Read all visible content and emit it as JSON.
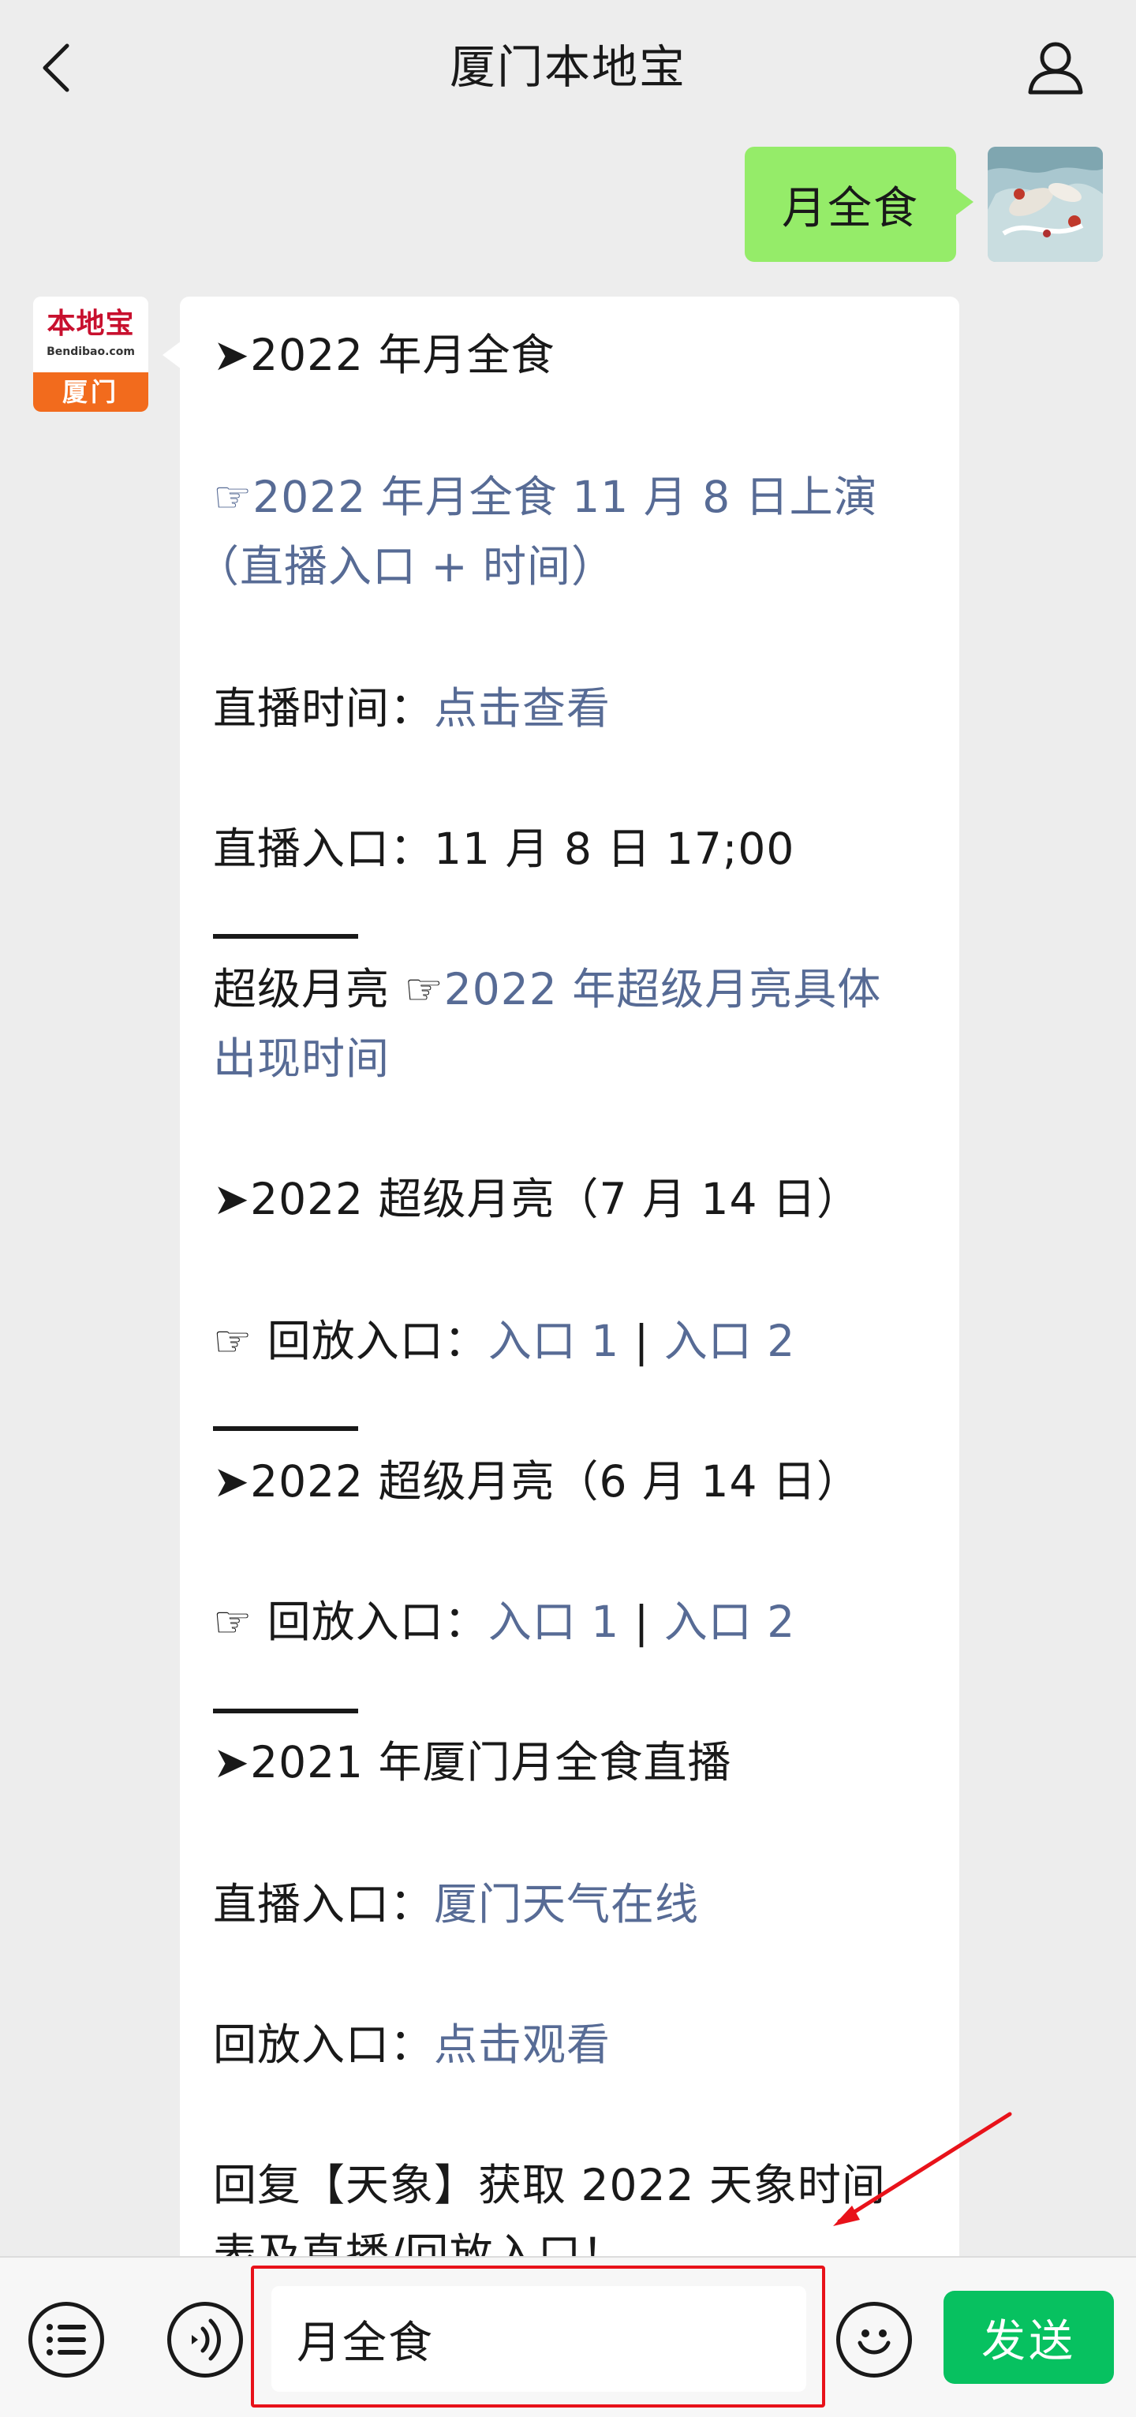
{
  "header": {
    "title": "厦门本地宝",
    "back_icon": "chevron-left-icon",
    "user_icon": "user-icon"
  },
  "sent_message": {
    "text": "月全食"
  },
  "bot_avatar": {
    "name": "本地宝",
    "url": "Bendibao.com",
    "city": "厦门"
  },
  "reply": {
    "lines": [
      {
        "type": "text",
        "parts": [
          {
            "t": "➤2022 年月全食"
          }
        ]
      },
      {
        "type": "text",
        "parts": [
          {
            "t": "☞2022 年月全食 11 月 8 日上演",
            "link": true
          }
        ]
      },
      {
        "type": "text",
        "parts": [
          {
            "t": "（直播入口 + 时间）",
            "link": true
          }
        ]
      },
      {
        "type": "text",
        "parts": [
          {
            "t": "直播时间："
          },
          {
            "t": "点击查看",
            "link": true
          }
        ]
      },
      {
        "type": "text",
        "parts": [
          {
            "t": "直播入口：11 月 8 日 17;00"
          }
        ]
      },
      {
        "type": "text",
        "parts": [
          {
            "t": "超级月亮 ☞"
          },
          {
            "t": "2022 年超级月亮具体",
            "link": true
          }
        ]
      },
      {
        "type": "text",
        "parts": [
          {
            "t": "出现时间",
            "link": true
          }
        ]
      },
      {
        "type": "text",
        "parts": [
          {
            "t": "➤2022 超级月亮（7 月 14 日）"
          }
        ]
      },
      {
        "type": "text",
        "parts": [
          {
            "t": "☞ 回放入口："
          },
          {
            "t": "入口 1",
            "link": true
          },
          {
            "t": " | "
          },
          {
            "t": "入口 2",
            "link": true
          }
        ]
      },
      {
        "type": "text",
        "parts": [
          {
            "t": "➤2022 超级月亮（6 月 14 日）"
          }
        ]
      },
      {
        "type": "text",
        "parts": [
          {
            "t": "☞ 回放入口："
          },
          {
            "t": "入口 1",
            "link": true
          },
          {
            "t": " | "
          },
          {
            "t": "入口 2",
            "link": true
          }
        ]
      },
      {
        "type": "text",
        "parts": [
          {
            "t": "➤2021 年厦门月全食直播"
          }
        ]
      },
      {
        "type": "text",
        "parts": [
          {
            "t": "直播入口："
          },
          {
            "t": "厦门天气在线",
            "link": true
          }
        ]
      },
      {
        "type": "text",
        "parts": [
          {
            "t": "回放入口："
          },
          {
            "t": "点击观看",
            "link": true
          }
        ]
      },
      {
        "type": "text",
        "parts": [
          {
            "t": "回复【天象】获取 2022 天象时间"
          }
        ]
      },
      {
        "type": "text",
        "parts": [
          {
            "t": "表及直播/回放入口！"
          }
        ]
      }
    ]
  },
  "input_bar": {
    "menu_icon": "list-menu-icon",
    "voice_icon": "voice-icon",
    "emoji_icon": "emoji-icon",
    "input_value": "月全食",
    "send_label": "发送"
  },
  "colors": {
    "background": "#ededed",
    "sent_bubble": "#95ec69",
    "link": "#576b95",
    "send_button": "#07c160",
    "annotation": "#e8121a"
  }
}
